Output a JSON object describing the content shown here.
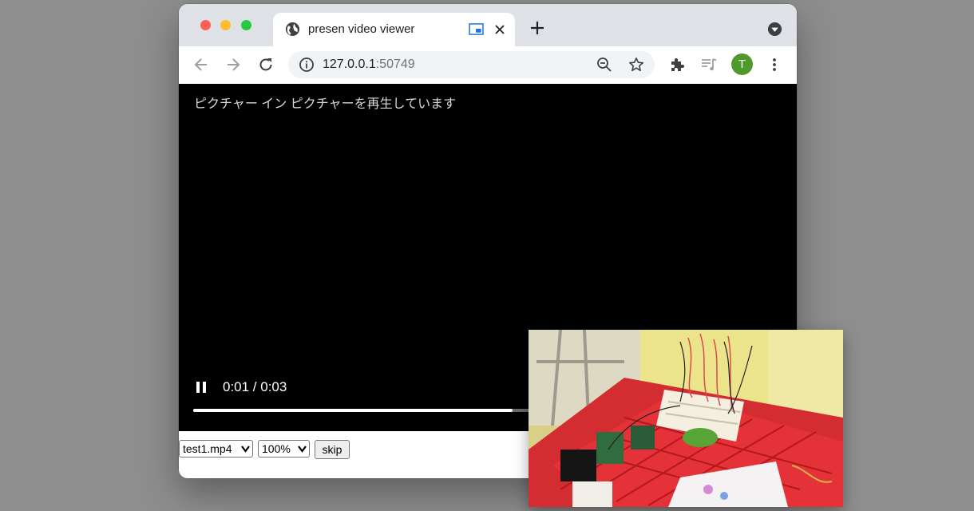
{
  "browser": {
    "tab": {
      "title": "presen video viewer"
    },
    "address_bar": {
      "host": "127.0.0.1",
      "port": ":50749"
    },
    "profile_initial": "T",
    "accent_color": "#1a73e8",
    "avatar_color": "#4f9a2b"
  },
  "page": {
    "pip_message": "ピクチャー イン ピクチャーを再生しています",
    "player": {
      "state": "playing",
      "time_display": "0:01 / 0:03",
      "progress": 0.54
    },
    "controls": {
      "file_select": {
        "selected": "test1.mp4"
      },
      "zoom_select": {
        "selected": "100%"
      },
      "skip_label": "skip"
    }
  },
  "pip_window": {
    "content": "video frame: breadboard with wires and small circuit boards on a red crate"
  },
  "icons": {
    "tab": [
      "globe-icon",
      "pip-indicator-icon",
      "close-icon"
    ],
    "tabstrip": [
      "new-tab-icon",
      "tab-search-icon"
    ],
    "toolbar": [
      "back-icon",
      "forward-icon",
      "reload-icon",
      "info-icon",
      "zoom-icon",
      "bookmark-star-icon",
      "extensions-icon",
      "media-control-icon",
      "menu-icon"
    ],
    "player": [
      "pause-icon"
    ]
  }
}
